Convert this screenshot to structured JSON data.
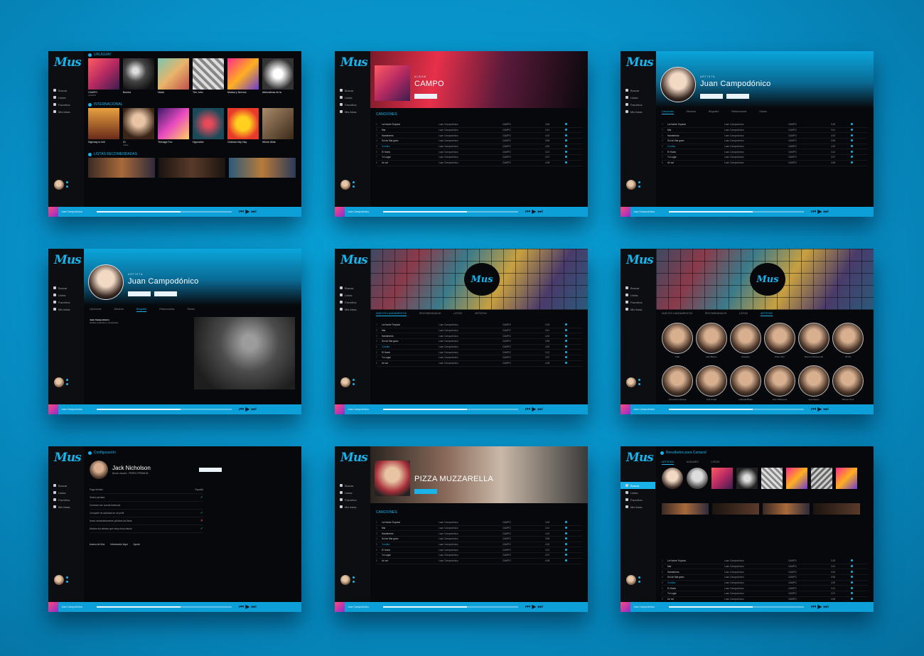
{
  "brand": {
    "logo": "Mus",
    "accent": "#19b3ea",
    "background": "#078fc6",
    "panel": "#07080b"
  },
  "sidebar": {
    "items": [
      {
        "label": "Buscar"
      },
      {
        "label": "Listas"
      },
      {
        "label": "Favoritos"
      },
      {
        "label": "Mis listas"
      }
    ]
  },
  "screens": {
    "home": {
      "sections": [
        {
          "title": "URUGUAY"
        },
        {
          "title": "INTERNACIONAL"
        },
        {
          "title": "LISTAS RECOMENDADAS"
        }
      ],
      "uruguay": [
        {
          "title": "CAMPO",
          "artist": "CAMPO"
        },
        {
          "title": "Bomba",
          "artist": ""
        },
        {
          "title": "Hazel",
          "artist": ""
        },
        {
          "title": "The John",
          "artist": ""
        },
        {
          "title": "Música y Nervios",
          "artist": ""
        },
        {
          "title": "Alternativas de la",
          "artist": ""
        }
      ],
      "internacional": [
        {
          "title": "Highway to hell",
          "artist": ""
        },
        {
          "title": "21",
          "artist": "Adele"
        },
        {
          "title": "Teenage Fun",
          "artist": ""
        },
        {
          "title": "Hypnotize",
          "artist": ""
        },
        {
          "title": "Chelsea Hay Hay",
          "artist": ""
        },
        {
          "title": "Whole Wide",
          "artist": ""
        }
      ]
    },
    "album": {
      "label": "ALBUM",
      "title": "CAMPO",
      "section": "CANCIONES"
    },
    "artist": {
      "label": "ARTISTA",
      "title": "Juan Campodónico",
      "tabs": [
        "Canciones",
        "Álbumes",
        "Biografía",
        "Relacionados",
        "Shows"
      ],
      "bio_title": "Juan Campodónico",
      "bio_sub": "Artista, productor y compositor"
    },
    "pizza": {
      "title": "PIZZA MUZZARELLA",
      "section": "CANCIONES"
    },
    "config": {
      "title": "Configuración",
      "user": "Jack Nicholson",
      "sub": "Nuevo usuario · PERFIL PREMIUM",
      "options": [
        {
          "label": "Pago término",
          "value": "Español"
        },
        {
          "label": "Sesión privada",
          "value": "ok"
        },
        {
          "label": "Conectar con cuenta facebook",
          "value": ""
        },
        {
          "label": "Compartir mi actividad en mi perfil",
          "value": "ok"
        },
        {
          "label": "Hacer automáticamente públicas las listas",
          "value": "no"
        },
        {
          "label": "Mostrar los artistas que estoy escuchando",
          "value": "ok"
        }
      ],
      "footer": [
        "Acerca de Mus",
        "Información legal",
        "Ayuda"
      ]
    },
    "search": {
      "title": "Resultados para Campod",
      "tabs": [
        "ARTISTAS",
        "ALBUMES",
        "LISTAS"
      ]
    },
    "grid": {
      "tabs": [
        "NUEVOS LANZAMIENTOS",
        "RECOMENDADOS",
        "LISTAS",
        "ARTISTAS"
      ]
    }
  },
  "songs": [
    {
      "n": "1",
      "title": "La Noche Tropical",
      "artist": "Luan Campodónico",
      "album": "CAMPO",
      "time": "3:18",
      "hl": false
    },
    {
      "n": "2",
      "title": "Mar",
      "artist": "Luan Campodónico",
      "album": "CAMPO",
      "time": "3:41",
      "hl": false
    },
    {
      "n": "3",
      "title": "Hambriento",
      "artist": "Luan Campodónico",
      "album": "CAMPO",
      "time": "4:02",
      "hl": false
    },
    {
      "n": "4",
      "title": "Sol de Mar gano",
      "artist": "Luan Campodónico",
      "album": "CAMPO",
      "time": "3:55",
      "hl": false
    },
    {
      "n": "5",
      "title": "Cumbia",
      "artist": "Luan Campodónico",
      "album": "CAMPO",
      "time": "4:20",
      "hl": true
    },
    {
      "n": "6",
      "title": "El Huelo",
      "artist": "Luan Campodónico",
      "album": "CAMPO",
      "time": "3:12",
      "hl": false
    },
    {
      "n": "7",
      "title": "Tu Lugar",
      "artist": "Luan Campodónico",
      "album": "CAMPO",
      "time": "3:37",
      "hl": false
    },
    {
      "n": "8",
      "title": "Un sol",
      "artist": "Luan Campodónico",
      "album": "CAMPO",
      "time": "4:08",
      "hl": false
    }
  ],
  "player": {
    "track": "Juan Campodónico",
    "subtitle": "CAMPO",
    "progress": 0.62
  },
  "people": [
    "Kalk",
    "Iván Blanco",
    "Grégoire",
    "Pitón Vivo",
    "Romeo Monteverde",
    "NTVG",
    "Fernando Cabrera",
    "Ana Prada",
    "Labrada Blues",
    "Iván Villanueva",
    "Juan Bosco",
    "Ramón Cruz"
  ]
}
